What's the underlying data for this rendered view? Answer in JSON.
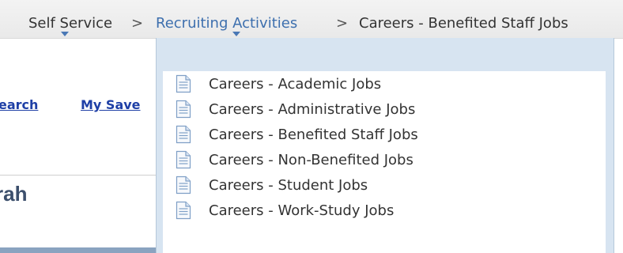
{
  "breadcrumb": {
    "items": [
      {
        "label": "Self Service"
      },
      {
        "label": "Recruiting Activities"
      },
      {
        "label": "Careers - Benefited Staff Jobs"
      }
    ],
    "separator": ">"
  },
  "background": {
    "links": [
      "earch",
      "My Save"
    ],
    "name_fragment": "rah"
  },
  "dropdown": {
    "items": [
      {
        "label": "Careers - Academic Jobs",
        "icon": "document-icon"
      },
      {
        "label": "Careers - Administrative Jobs",
        "icon": "document-icon"
      },
      {
        "label": "Careers - Benefited Staff Jobs",
        "icon": "document-icon"
      },
      {
        "label": "Careers - Non-Benefited Jobs",
        "icon": "document-icon"
      },
      {
        "label": "Careers - Student Jobs",
        "icon": "document-icon"
      },
      {
        "label": "Careers - Work-Study Jobs",
        "icon": "document-icon"
      }
    ]
  },
  "colors": {
    "breadcrumb_active": "#3d6fae",
    "link": "#1e3fa6",
    "dropdown_bg": "#d7e4f1"
  }
}
